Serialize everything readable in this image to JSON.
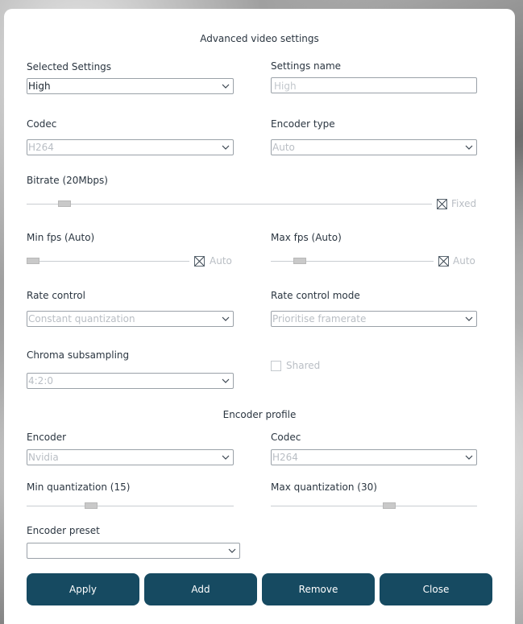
{
  "dialog": {
    "title": "Advanced video settings",
    "selected_settings": {
      "label": "Selected Settings",
      "value": "High"
    },
    "settings_name": {
      "label": "Settings name",
      "placeholder": "High"
    },
    "codec": {
      "label": "Codec",
      "value": "H264"
    },
    "encoder_type": {
      "label": "Encoder type",
      "value": "Auto"
    },
    "bitrate": {
      "label": "Bitrate (20Mbps)",
      "level": 0.08,
      "fixed_label": "Fixed",
      "fixed_checked": true
    },
    "min_fps": {
      "label": "Min fps (Auto)",
      "level": 0.0,
      "auto_label": "Auto",
      "auto_checked": true
    },
    "max_fps": {
      "label": "Max fps (Auto)",
      "level": 0.15,
      "auto_label": "Auto",
      "auto_checked": true
    },
    "rate_control": {
      "label": "Rate control",
      "value": "Constant quantization"
    },
    "rate_control_mode": {
      "label": "Rate control mode",
      "value": "Prioritise framerate"
    },
    "chroma_subsampling": {
      "label": "Chroma subsampling",
      "value": "4:2:0"
    },
    "shared": {
      "label": "Shared",
      "checked": false
    },
    "encoder_profile": {
      "title": "Encoder profile",
      "encoder": {
        "label": "Encoder",
        "value": "Nvidia"
      },
      "codec": {
        "label": "Codec",
        "value": "H264"
      },
      "min_quantization": {
        "label": "Min quantization (15)",
        "level": 0.3
      },
      "max_quantization": {
        "label": "Max quantization (30)",
        "level": 0.58
      },
      "encoder_preset": {
        "label": "Encoder preset",
        "value": ""
      }
    },
    "buttons": {
      "apply": "Apply",
      "add": "Add",
      "remove": "Remove",
      "close": "Close"
    },
    "colors": {
      "button": "#164a61",
      "text": "#2a3540",
      "disabled_text": "#b9bec4"
    }
  }
}
